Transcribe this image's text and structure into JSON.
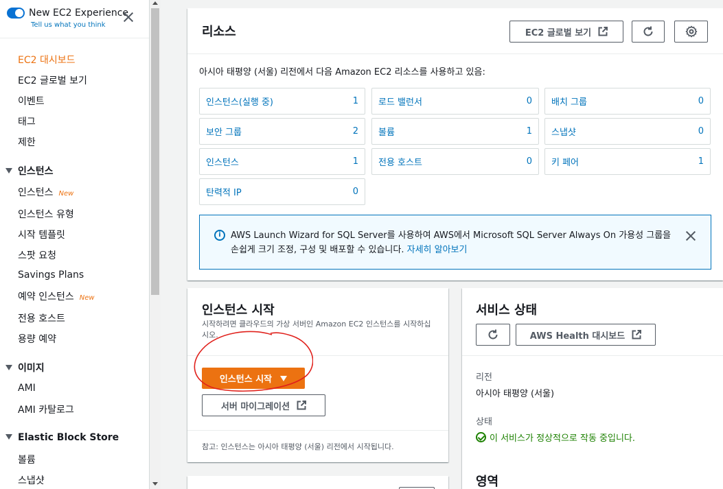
{
  "sidebar": {
    "experience_title": "New EC2 Experience",
    "experience_sub": "Tell us what you think",
    "items": [
      {
        "label": "EC2 대시보드"
      },
      {
        "label": "EC2 글로벌 보기"
      },
      {
        "label": "이벤트"
      },
      {
        "label": "태그"
      },
      {
        "label": "제한"
      }
    ],
    "sections": [
      {
        "title": "인스턴스",
        "items": [
          {
            "label": "인스턴스",
            "badge": "New"
          },
          {
            "label": "인스턴스 유형"
          },
          {
            "label": "시작 템플릿"
          },
          {
            "label": "스팟 요청"
          },
          {
            "label": "Savings Plans"
          },
          {
            "label": "예약 인스턴스",
            "badge": "New"
          },
          {
            "label": "전용 호스트"
          },
          {
            "label": "용량 예약"
          }
        ]
      },
      {
        "title": "이미지",
        "items": [
          {
            "label": "AMI"
          },
          {
            "label": "AMI 카탈로그"
          }
        ]
      },
      {
        "title": "Elastic Block Store",
        "items": [
          {
            "label": "볼륨"
          },
          {
            "label": "스냅샷"
          }
        ]
      }
    ]
  },
  "resources": {
    "title": "리소스",
    "global_view_label": "EC2 글로벌 보기",
    "description": "아시아 태평양 (서울) 리전에서 다음 Amazon EC2 리소스를 사용하고 있음:",
    "tiles": [
      {
        "label": "인스턴스(실행 중)",
        "count": "1"
      },
      {
        "label": "로드 밸런서",
        "count": "0"
      },
      {
        "label": "배치 그룹",
        "count": "0"
      },
      {
        "label": "보안 그룹",
        "count": "2"
      },
      {
        "label": "볼륨",
        "count": "1"
      },
      {
        "label": "스냅샷",
        "count": "0"
      },
      {
        "label": "인스턴스",
        "count": "1"
      },
      {
        "label": "전용 호스트",
        "count": "0"
      },
      {
        "label": "키 페어",
        "count": "1"
      },
      {
        "label": "탄력적 IP",
        "count": "0"
      }
    ],
    "info_text": "AWS Launch Wizard for SQL Server를 사용하여 AWS에서 Microsoft SQL Server Always On 가용성 그룹을 손쉽게 크기 조정, 구성 및 배포할 수 있습니다.",
    "info_link": "자세히 알아보기"
  },
  "launch": {
    "title": "인스턴스 시작",
    "description": "시작하려면 클라우드의 가상 서버인 Amazon EC2 인스턴스를 시작하십시오.",
    "launch_button": "인스턴스 시작",
    "migrate_button": "서버 마이그레이션",
    "note": "참고: 인스턴스는 아시아 태평양 (서울) 리전에서 시작됩니다."
  },
  "health": {
    "title": "서비스 상태",
    "dashboard_button": "AWS Health 대시보드",
    "region_label": "리전",
    "region_value": "아시아 태평양 (서울)",
    "status_label": "상태",
    "status_value": "이 서비스가 정상적으로 작동 중입니다.",
    "zone_title": "영역"
  },
  "colors": {
    "accent": "#ec7211",
    "link": "#0073bb",
    "ok": "#1d8102",
    "annotation": "#e0201b"
  }
}
